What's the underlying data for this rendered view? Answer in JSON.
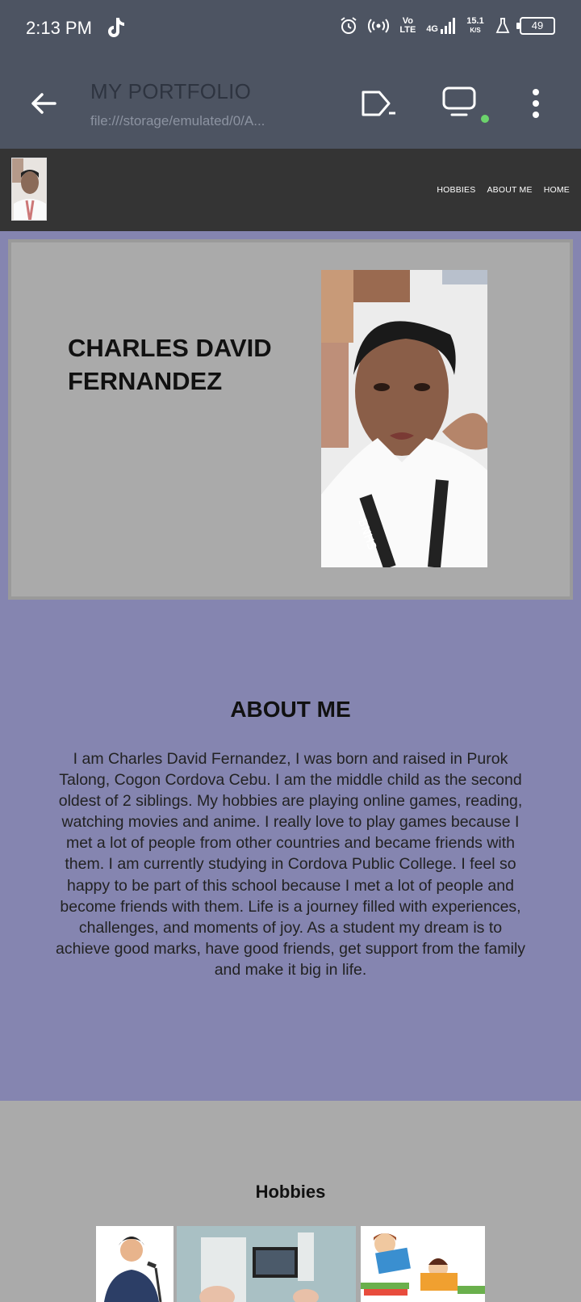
{
  "status_bar": {
    "time": "2:13 PM",
    "volte": "Vo LTE",
    "network": "4G",
    "speed_value": "15.1",
    "speed_unit": "K/S",
    "battery": "49"
  },
  "browser": {
    "page_title": "MY PORTFOLIO",
    "url": "file:///storage/emulated/0/A..."
  },
  "site": {
    "nav": [
      "HOBBIES",
      "ABOUT ME",
      "HOME"
    ]
  },
  "hero": {
    "name": "CHARLES DAVID FERNANDEZ"
  },
  "about": {
    "title": "ABOUT ME",
    "text": "I am Charles David Fernandez, I was born and raised in Purok Talong, Cogon Cordova Cebu. I am the middle child as the second oldest of 2 siblings. My hobbies are playing online games, reading, watching movies and anime. I really love to play games because I met a lot of people from other countries and became friends with them. I am currently studying in Cordova Public College. I feel so happy to be part of this school because I met a lot of people and become friends with them. Life is a journey filled with experiences, challenges, and moments of joy. As a student my dream is to achieve good marks, have good friends, get support from the family and make it big in life."
  },
  "hobbies": {
    "title": "Hobbies"
  },
  "colors": {
    "chrome": "#4d5462",
    "site_header": "#343434",
    "accent_purple": "#8585b0",
    "panel_gray": "#aaaaaa"
  }
}
